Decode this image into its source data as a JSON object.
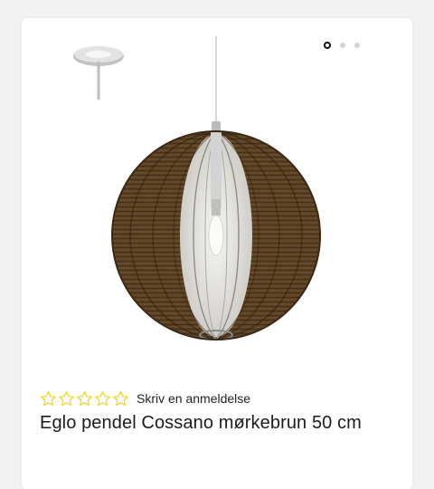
{
  "carousel": {
    "slides": [
      "lamp-slide-1",
      "lamp-slide-2",
      "lamp-slide-3"
    ],
    "active_index": 0
  },
  "rating": {
    "stars_filled": 0,
    "stars_total": 5,
    "star_color": "#f2d10a",
    "review_link_label": "Skriv en anmeldelse"
  },
  "product": {
    "title": "Eglo pendel Cossano mørkebrun 50 cm"
  }
}
